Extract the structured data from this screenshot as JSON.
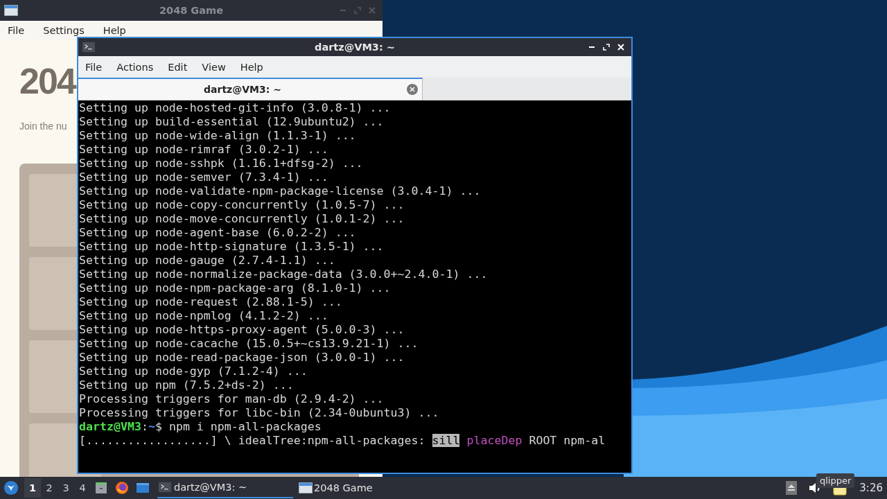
{
  "game_window": {
    "title": "2048 Game",
    "active": false,
    "menu": [
      "File",
      "Settings",
      "Help"
    ],
    "heading": "204",
    "subtitle": "Join the nu"
  },
  "terminal_window": {
    "title": "dartz@VM3: ~",
    "active": true,
    "menu": [
      "File",
      "Actions",
      "Edit",
      "View",
      "Help"
    ],
    "tabs": [
      {
        "label": "dartz@VM3: ~",
        "selected": true
      }
    ],
    "lines": [
      {
        "text": "Setting up node-hosted-git-info (3.0.8-1) ..."
      },
      {
        "text": "Setting up build-essential (12.9ubuntu2) ..."
      },
      {
        "text": "Setting up node-wide-align (1.1.3-1) ..."
      },
      {
        "text": "Setting up node-rimraf (3.0.2-1) ..."
      },
      {
        "text": "Setting up node-sshpk (1.16.1+dfsg-2) ..."
      },
      {
        "text": "Setting up node-semver (7.3.4-1) ..."
      },
      {
        "text": "Setting up node-validate-npm-package-license (3.0.4-1) ..."
      },
      {
        "text": "Setting up node-copy-concurrently (1.0.5-7) ..."
      },
      {
        "text": "Setting up node-move-concurrently (1.0.1-2) ..."
      },
      {
        "text": "Setting up node-agent-base (6.0.2-2) ..."
      },
      {
        "text": "Setting up node-http-signature (1.3.5-1) ..."
      },
      {
        "text": "Setting up node-gauge (2.7.4-1.1) ..."
      },
      {
        "text": "Setting up node-normalize-package-data (3.0.0+~2.4.0-1) ..."
      },
      {
        "text": "Setting up node-npm-package-arg (8.1.0-1) ..."
      },
      {
        "text": "Setting up node-request (2.88.1-5) ..."
      },
      {
        "text": "Setting up node-npmlog (4.1.2-2) ..."
      },
      {
        "text": "Setting up node-https-proxy-agent (5.0.0-3) ..."
      },
      {
        "text": "Setting up node-cacache (15.0.5+~cs13.9.21-1) ..."
      },
      {
        "text": "Setting up node-read-package-json (3.0.0-1) ..."
      },
      {
        "text": "Setting up node-gyp (7.1.2-4) ..."
      },
      {
        "text": "Setting up npm (7.5.2+ds-2) ..."
      },
      {
        "text": "Processing triggers for man-db (2.9.4-2) ..."
      },
      {
        "text": "Processing triggers for libc-bin (2.34-0ubuntu3) ..."
      },
      {
        "segments": [
          {
            "text": "dartz@VM3",
            "kind": "user"
          },
          {
            "text": ":",
            "kind": "plain"
          },
          {
            "text": "~",
            "kind": "path"
          },
          {
            "text": "$ npm i npm-all-packages",
            "kind": "plain"
          }
        ]
      },
      {
        "segments": [
          {
            "text": "[..................] \\ idealTree:npm-all-packages: ",
            "kind": "plain"
          },
          {
            "text": "sill",
            "kind": "badge"
          },
          {
            "text": " placeDep",
            "kind": "magenta"
          },
          {
            "text": " ROOT npm-al",
            "kind": "plain"
          }
        ]
      }
    ]
  },
  "taskbar": {
    "workspaces": [
      {
        "label": "1",
        "selected": true
      },
      {
        "label": "2",
        "selected": false
      },
      {
        "label": "3",
        "selected": false
      },
      {
        "label": "4",
        "selected": false
      }
    ],
    "tasks": [
      {
        "label": "dartz@VM3: ~",
        "kind": "terminal",
        "selected": true
      },
      {
        "label": "2048 Game",
        "kind": "window",
        "selected": false
      }
    ],
    "clock": "3:26",
    "tooltip": "qlipper"
  }
}
